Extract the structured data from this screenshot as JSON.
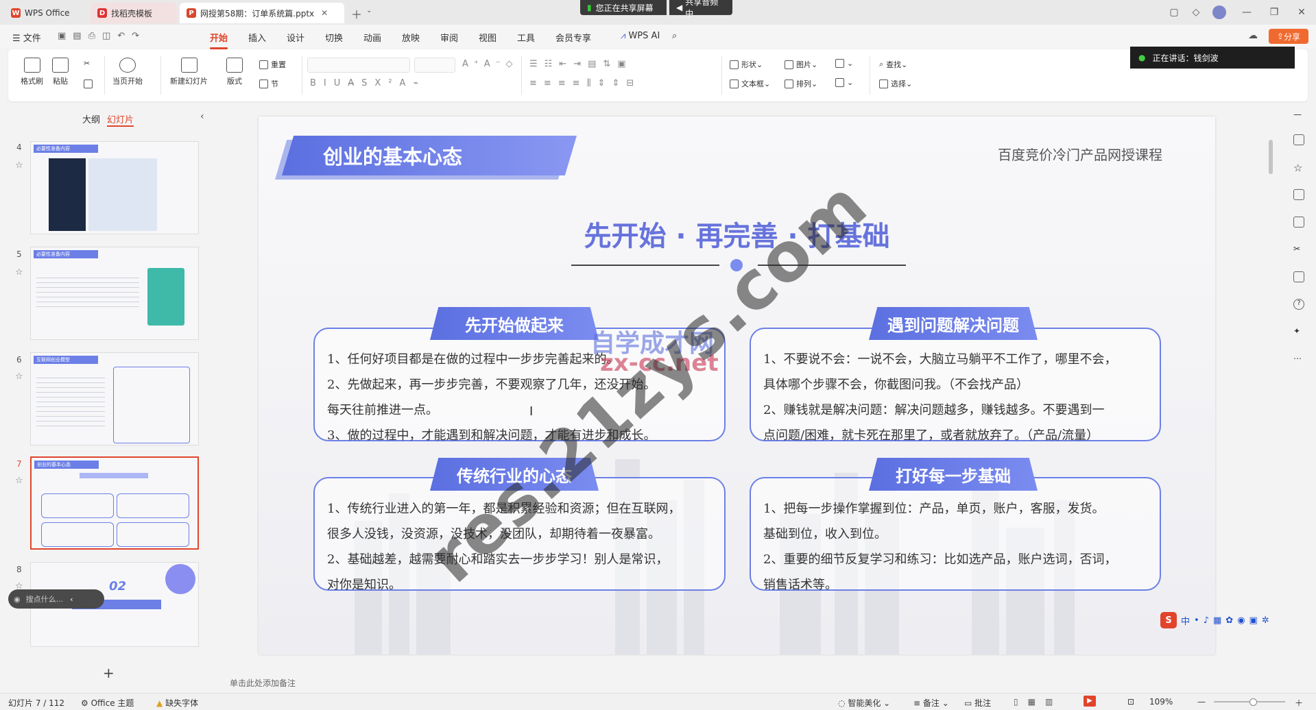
{
  "titlebar": {
    "tabs": [
      {
        "label": "WPS Office"
      },
      {
        "label": "找稻壳模板"
      },
      {
        "label": "网授第58期：订单系统篇.pptx"
      }
    ],
    "sharing_label": "您正在共享屏幕",
    "audio_label": "共享音频中"
  },
  "menu": {
    "file": "文件",
    "items": [
      "开始",
      "插入",
      "设计",
      "切换",
      "动画",
      "放映",
      "审阅",
      "视图",
      "工具",
      "会员专享"
    ],
    "wps_ai": "WPS AI",
    "share": "分享"
  },
  "ribbon": {
    "format_painter": "格式刷",
    "paste": "粘贴",
    "play_from_current": "当页开始",
    "new_slide": "新建幻灯片",
    "layout": "版式",
    "reset": "重置",
    "section": "节",
    "shape": "形状",
    "picture": "图片",
    "textbox": "文本框",
    "arrange": "排列",
    "find": "查找",
    "select": "选择"
  },
  "speaker": {
    "label": "正在讲话：钱剑波"
  },
  "left_panel": {
    "tab_outline": "大纲",
    "tab_slides": "幻灯片",
    "thumbs": [
      {
        "num": "4",
        "title": "必要性准备内容"
      },
      {
        "num": "5",
        "title": "必要性准备内容"
      },
      {
        "num": "6",
        "title": "互联网创业模型"
      },
      {
        "num": "7",
        "title": "创业的基本心态"
      },
      {
        "num": "8",
        "title": "02"
      }
    ],
    "add": "+",
    "search_placeholder": "搜点什么..."
  },
  "slide": {
    "title": "创业的基本心态",
    "course": "百度竞价冷门产品网授课程",
    "headline": "先开始 · 再完善 · 打基础",
    "panels": [
      {
        "title": "先开始做起来",
        "lines": [
          "1、任何好项目都是在做的过程中一步步完善起来的。",
          "2、先做起来，再一步步完善，不要观察了几年，还没开始。",
          "每天往前推进一点。",
          "3、做的过程中，才能遇到和解决问题，才能有进步和成长。"
        ]
      },
      {
        "title": "遇到问题解决问题",
        "lines": [
          "1、不要说不会：一说不会，大脑立马躺平不工作了，哪里不会，",
          "具体哪个步骤不会，你截图问我。（不会找产品）",
          "2、赚钱就是解决问题：解决问题越多，赚钱越多。不要遇到一",
          "点问题/困难，就卡死在那里了，或者就放弃了。（产品/流量）"
        ]
      },
      {
        "title": "传统行业的心态",
        "lines": [
          "1、传统行业进入的第一年，都是积累经验和资源；但在互联网，",
          "很多人没钱，没资源，没技术，没团队，却期待着一夜暴富。",
          "2、基础越差，越需要耐心和踏实去一步步学习！别人是常识，",
          "对你是知识。"
        ]
      },
      {
        "title": "打好每一步基础",
        "lines": [
          "1、把每一步操作掌握到位：产品，单页，账户，客服，发货。",
          "基础到位，收入到位。",
          "2、重要的细节反复学习和练习：比如选产品，账户选词，否词，",
          "销售话术等。"
        ]
      }
    ]
  },
  "watermarks": {
    "big": "res.21zys.com",
    "small1": "自学成才网",
    "small2": "zx-cc.net"
  },
  "notes_placeholder": "单击此处添加备注",
  "statusbar": {
    "slide_count": "幻灯片 7 / 112",
    "theme": "Office 主题",
    "missing_font": "缺失字体",
    "beautify": "智能美化",
    "notes": "备注",
    "comments": "批注",
    "zoom": "109%"
  },
  "colors": {
    "accent": "#e0452c",
    "panel_blue": "#6b7fe6",
    "title_blue": "#5b6fe0"
  }
}
